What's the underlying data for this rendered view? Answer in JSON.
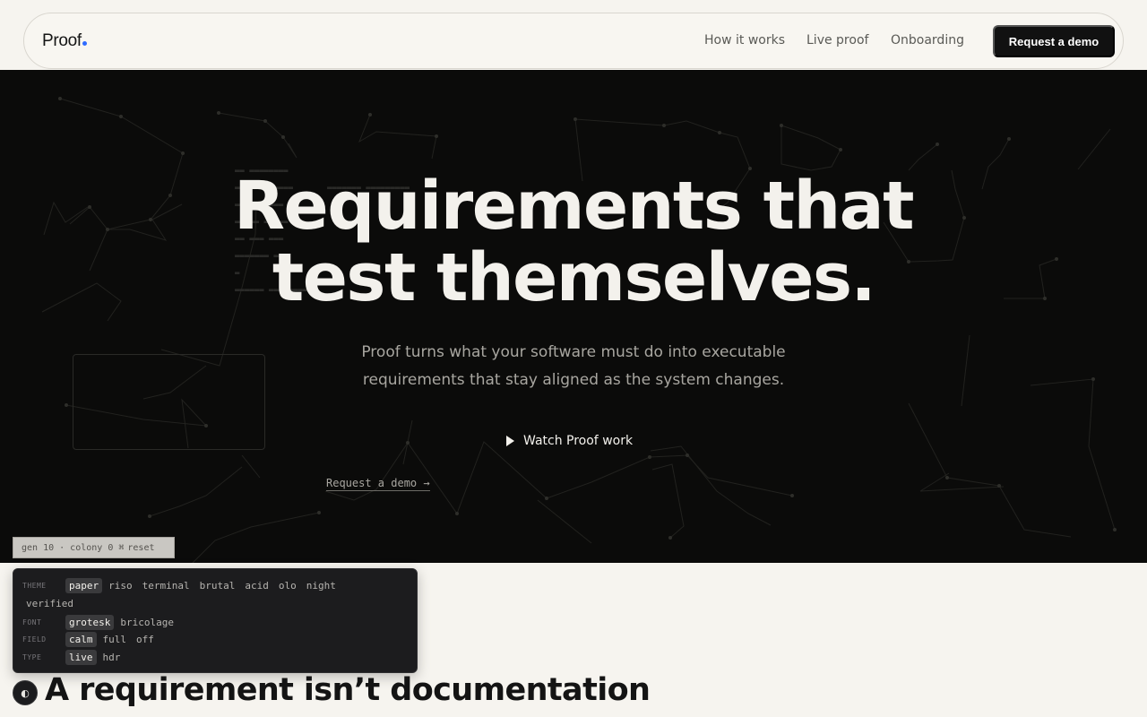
{
  "header": {
    "brand": "Proof",
    "nav": [
      "How it works",
      "Live proof",
      "Onboarding"
    ],
    "cta": "Request a demo",
    "brand_dot_color": "#2f6bff"
  },
  "hero": {
    "title_line1": "Requirements that",
    "title_line2": "test themselves.",
    "subtitle_line1": "Proof turns what your software must do into executable",
    "subtitle_line2": "requirements that stay aligned as the system changes.",
    "watch_label": "Watch Proof work",
    "demo_link": "Request a demo →",
    "background_color": "#0b0b0a"
  },
  "gen_bar": {
    "status": "gen 10 · colony 0 ⌘",
    "reset": "reset"
  },
  "settings_panel": {
    "theme": {
      "label": "THEME",
      "options": [
        "paper",
        "riso",
        "terminal",
        "brutal",
        "acid",
        "olo",
        "night",
        "verified"
      ],
      "selected": "paper"
    },
    "font": {
      "label": "FONT",
      "options": [
        "grotesk",
        "bricolage"
      ],
      "selected": "grotesk"
    },
    "field": {
      "label": "FIELD",
      "options": [
        "calm",
        "full",
        "off"
      ],
      "selected": "calm"
    },
    "type": {
      "label": "TYPE",
      "options": [
        "live",
        "hdr"
      ],
      "selected": "live"
    }
  },
  "section": {
    "title": "A requirement isn’t documentation",
    "toggle_icon": "half-circle-contrast-icon",
    "toggle_glyph": "◐"
  }
}
